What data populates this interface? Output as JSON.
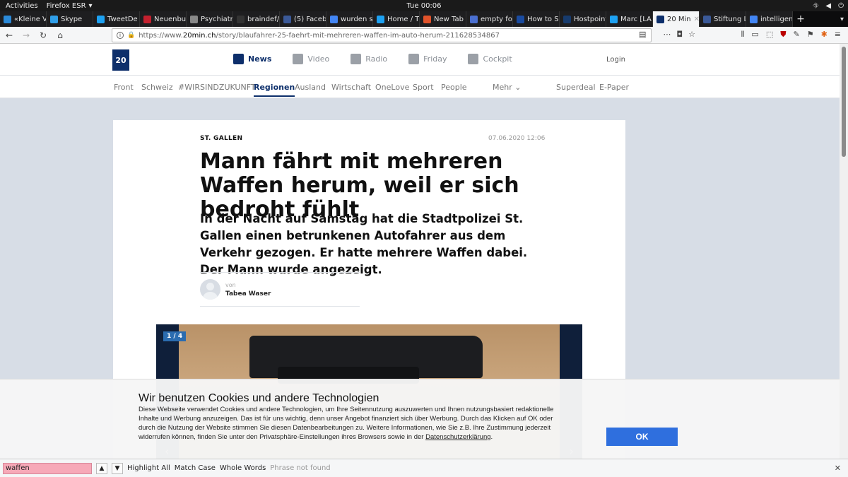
{
  "system_bar": {
    "activities": "Activities",
    "app": "Firefox ESR",
    "clock": "Tue 00:06"
  },
  "tabs": [
    {
      "label": "«Kleine V",
      "color": "#2b8ad9"
    },
    {
      "label": "Skype",
      "color": "#2f9ee8"
    },
    {
      "label": "TweetDe",
      "color": "#1da1f2"
    },
    {
      "label": "Neuenbur",
      "color": "#c4202e"
    },
    {
      "label": "Psychiatrie L",
      "color": "#888888"
    },
    {
      "label": "braindef/",
      "color": "#333333"
    },
    {
      "label": "(5) Faceb",
      "color": "#3b5998"
    },
    {
      "label": "wurden s",
      "color": "#4285f4"
    },
    {
      "label": "Home / T",
      "color": "#1da1f2"
    },
    {
      "label": "New Tab",
      "color": "#e0522a"
    },
    {
      "label": "empty fol",
      "color": "#4a6fd1"
    },
    {
      "label": "How to Sp",
      "color": "#1a4ba0"
    },
    {
      "label": "Hostpoint",
      "color": "#173b6d"
    },
    {
      "label": "Marc [LA",
      "color": "#1da1f2"
    },
    {
      "label": "20 Min",
      "color": "#0d2f6b",
      "active": true
    },
    {
      "label": "Stiftung L",
      "color": "#3b5998"
    },
    {
      "label": "intelligen",
      "color": "#4285f4"
    }
  ],
  "url": {
    "prefix": "https://www.",
    "domain": "20min.ch",
    "path": "/story/blaufahrer-25-faehrt-mit-mehreren-waffen-im-auto-herum-211628534867"
  },
  "site": {
    "logo": "20",
    "main_nav": [
      "News",
      "Video",
      "Radio",
      "Friday",
      "Cockpit"
    ],
    "login": "Login",
    "sub_nav": [
      "Front",
      "Schweiz",
      "#WIRSINDZUKUNFT",
      "Regionen",
      "Ausland",
      "Wirtschaft",
      "OneLove",
      "Sport",
      "People",
      "Mehr ⌄",
      "Superdeal",
      "E-Paper"
    ]
  },
  "article": {
    "category": "ST. GALLEN",
    "date": "07.06.2020 12:06",
    "title": "Mann fährt mit mehreren Waffen herum, weil er sich bedroht fühlt",
    "lead": "In der Nacht auf Samstag hat die Stadtpolizei St. Gallen einen betrunkenen Autofahrer aus dem Verkehr gezogen. Er hatte mehrere Waffen dabei. Der Mann wurde angezeigt.",
    "by": "von",
    "author": "Tabea Waser",
    "gallery_counter": "1 / 4"
  },
  "cookie": {
    "title": "Wir benutzen Cookies und andere Technologien",
    "text": "Diese Webseite verwendet Cookies und andere Technologien, um Ihre Seitennutzung auszuwerten und Ihnen nutzungsbasiert redaktionelle Inhalte und Werbung anzuzeigen. Das ist für uns wichtig, denn unser Angebot finanziert sich über Werbung. Durch das Klicken auf OK oder durch die Nutzung der Website stimmen Sie diesen Datenbearbeitungen zu. Weitere Informationen, wie Sie z.B. Ihre Zustimmung jederzeit widerrufen können, finden Sie unter den Privatsphäre-Einstellungen ihres Browsers sowie in der ",
    "link": "Datenschutzerklärung",
    "after": ".",
    "ok": "OK"
  },
  "findbar": {
    "query": "waffen",
    "highlight_all": "Highlight All",
    "match_case": "Match Case",
    "whole_words": "Whole Words",
    "status": "Phrase not found"
  }
}
